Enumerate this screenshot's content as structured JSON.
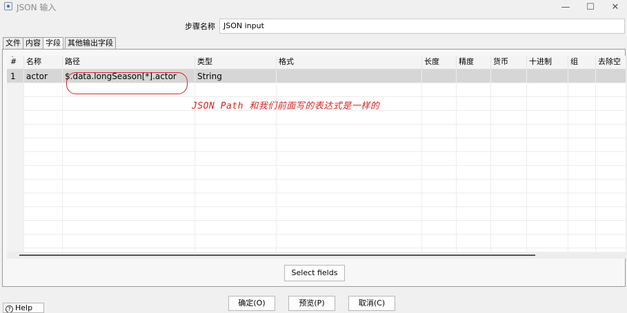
{
  "window": {
    "title": "JSON 输入"
  },
  "step": {
    "label": "步骤名称",
    "value": "JSON input"
  },
  "tabs": [
    {
      "label": "文件",
      "active": false
    },
    {
      "label": "内容",
      "active": false
    },
    {
      "label": "字段",
      "active": true
    },
    {
      "label": "其他输出字段",
      "active": false
    }
  ],
  "grid": {
    "columns": [
      "#",
      "名称",
      "路径",
      "类型",
      "格式",
      "长度",
      "精度",
      "货币",
      "十进制",
      "组",
      "去除空"
    ],
    "rows": [
      {
        "num": "1",
        "name": "actor",
        "path": "$.data.longSeason[*].actor",
        "type": "String",
        "format": "",
        "length": "",
        "precision": "",
        "currency": "",
        "decimal": "",
        "group": "",
        "trim": ""
      }
    ]
  },
  "annotation": {
    "text": "JSON Path 和我们前面写的表达式是一样的",
    "color": "#d42424"
  },
  "buttons": {
    "select_fields": "Select fields",
    "help": "Help",
    "ok": "确定(O)",
    "preview": "预览(P)",
    "cancel": "取消(C)"
  }
}
